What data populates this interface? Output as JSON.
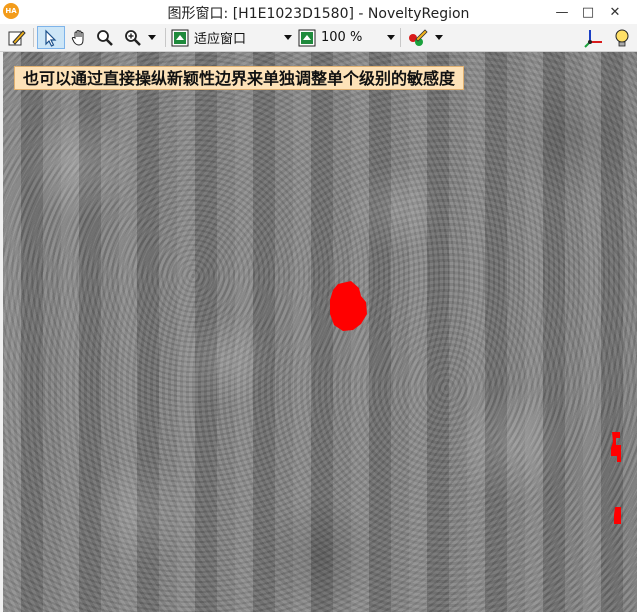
{
  "window": {
    "title": "图形窗口: [H1E1023D1580] - NoveltyRegion",
    "logo_text": "HA",
    "minimize_glyph": "—",
    "maximize_glyph": "□",
    "close_glyph": "✕"
  },
  "toolbar": {
    "fit_window_label": "适应窗口",
    "zoom_label": "100 %",
    "icons": [
      "edit-icon",
      "pointer-icon",
      "hand-icon",
      "magnify-icon",
      "zoom-in-icon",
      "fit-window-icon",
      "zoom-percent-icon",
      "color-draw-icon",
      "axis-icon",
      "lightbulb-icon"
    ]
  },
  "canvas": {
    "banner_text": "也可以通过直接操纵新颖性边界来单独调整单个级别的敏感度",
    "region_color": "#ff0000"
  }
}
